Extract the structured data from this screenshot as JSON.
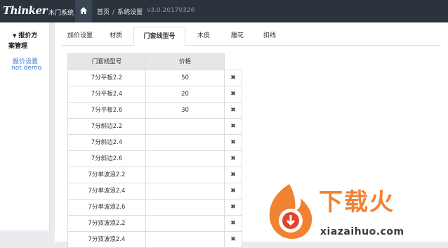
{
  "header": {
    "logo": "Thinker",
    "app_name": "木门系统",
    "breadcrumb_home": "首页",
    "breadcrumb_sep": "/",
    "breadcrumb_current": "系统设置",
    "version": "v3.0.20170326"
  },
  "sidebar": {
    "group_title": "报价方",
    "group_title_line2": "案管理",
    "link1": "报价设置",
    "link2": "not demo"
  },
  "tabs": [
    "加价设置",
    "材质",
    "门套线型号",
    "木皮",
    "雕花",
    "扣线"
  ],
  "active_tab": "门套线型号",
  "table": {
    "headers": [
      "门套线型号",
      "价格"
    ],
    "rows": [
      {
        "model": "7分平板2.2",
        "price": "50"
      },
      {
        "model": "7分平板2.4",
        "price": "20"
      },
      {
        "model": "7分平板2.6",
        "price": "30"
      },
      {
        "model": "7分斜边2.2",
        "price": ""
      },
      {
        "model": "7分斜边2.4",
        "price": ""
      },
      {
        "model": "7分斜边2.6",
        "price": ""
      },
      {
        "model": "7分单波浪2.2",
        "price": ""
      },
      {
        "model": "7分单波浪2.4",
        "price": ""
      },
      {
        "model": "7分单波浪2.6",
        "price": ""
      },
      {
        "model": "7分双波浪2.2",
        "price": ""
      },
      {
        "model": "7分双波浪2.4",
        "price": ""
      }
    ],
    "delete_glyph": "✖"
  },
  "watermark": {
    "brand": "下载火",
    "url": "xiazaihuo.com"
  },
  "colors": {
    "topbar": "#2b333d",
    "accent_link": "#3a7bd5",
    "watermark": "#f08232"
  }
}
